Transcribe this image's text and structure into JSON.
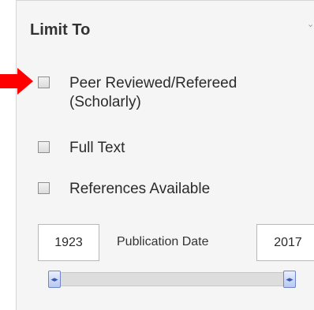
{
  "panel": {
    "title": "Limit To",
    "collapse_icon": "chevron-down-icon"
  },
  "options": {
    "peer_reviewed": "Peer Reviewed/Refereed (Scholarly)",
    "full_text": "Full Text",
    "references": "References Available"
  },
  "date_range": {
    "start": "1923",
    "label": "Publication Date",
    "end": "2017",
    "slider_start_fraction": 0,
    "slider_end_fraction": 1
  },
  "colors": {
    "arrow": "#ff0000",
    "panel_background": "#f5f5f5",
    "slider_handle": "#b7c8f0"
  }
}
